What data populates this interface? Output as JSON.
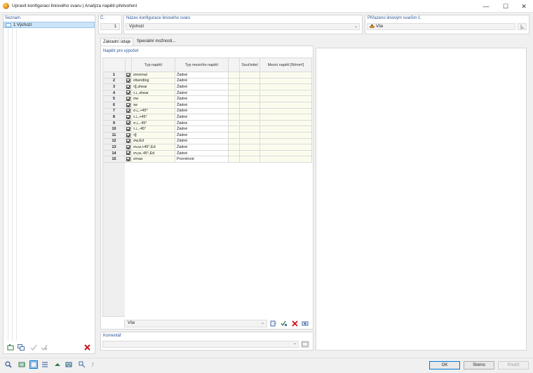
{
  "window": {
    "title": "Upravit konfiguraci liniového svaru | Analýza napětí-přetvoření",
    "controls": {
      "minimize": "—",
      "maximize": "☐",
      "close": "✕"
    }
  },
  "list": {
    "label": "Seznam",
    "items": [
      {
        "text": "1  Výchozí"
      }
    ]
  },
  "header": {
    "no_label": "Č.",
    "no_value": "1",
    "name_label": "Název konfigurace liniového svaru",
    "name_value": "Výchozí",
    "assigned_label": "Přiřazeno liniovým svarům č.",
    "assigned_value": "Vše"
  },
  "tabs": [
    {
      "label": "Základní údaje",
      "active": true
    },
    {
      "label": "Speciální možnosti...",
      "active": false
    }
  ],
  "section": {
    "title": "Napětí pro výpočet"
  },
  "table": {
    "headers": {
      "type": "Typ napětí",
      "limit_type": "Typ mezního napětí",
      "factor": "Součinitel",
      "limit": "Mezní napětí [N/mm²]"
    },
    "rows": [
      {
        "no": "1",
        "type": "σnormal",
        "limit": "Žádné"
      },
      {
        "no": "2",
        "type": "σbending",
        "limit": "Žádné"
      },
      {
        "no": "3",
        "type": "τ∥,shear",
        "limit": "Žádné"
      },
      {
        "no": "4",
        "type": "τ⊥,shear",
        "limit": "Žádné"
      },
      {
        "no": "5",
        "type": "σw",
        "limit": "Žádné"
      },
      {
        "no": "6",
        "type": "τw",
        "limit": "Žádné"
      },
      {
        "no": "7",
        "type": "σ⊥,+45°",
        "limit": "Žádné"
      },
      {
        "no": "8",
        "type": "τ⊥,+45°",
        "limit": "Žádné"
      },
      {
        "no": "9",
        "type": "σ⊥,-45°",
        "limit": "Žádné"
      },
      {
        "no": "10",
        "type": "τ⊥,-45°",
        "limit": "Žádné"
      },
      {
        "no": "11",
        "type": "τ∥",
        "limit": "Žádné"
      },
      {
        "no": "12",
        "type": "σw,Ed",
        "limit": "Žádné"
      },
      {
        "no": "13",
        "type": "σv,w,+45°,Ed",
        "limit": "Žádné"
      },
      {
        "no": "14",
        "type": "σv,w,-45°,Ed",
        "limit": "Žádné"
      },
      {
        "no": "15",
        "type": "σmax",
        "limit": "Proměnné"
      }
    ],
    "filter_value": "Vše"
  },
  "comment": {
    "label": "Komentář"
  },
  "buttons": {
    "ok": "OK",
    "cancel": "Storno",
    "apply": "Použít"
  },
  "colors": {
    "accent": "#0078d7",
    "label_blue": "#2b5797",
    "selection": "#cce4f7",
    "cell_yellow": "#fbfcee"
  }
}
